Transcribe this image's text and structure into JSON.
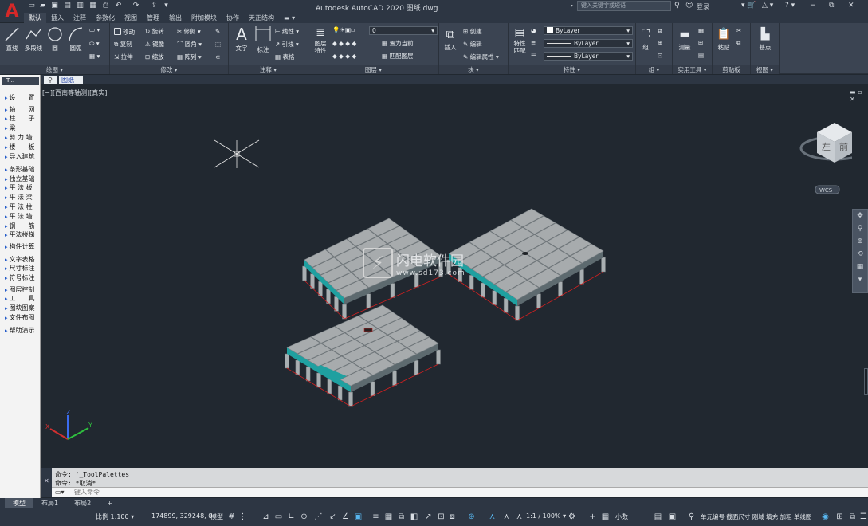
{
  "app": {
    "title": "Autodesk AutoCAD 2020    图纸.dwg",
    "logo": "A",
    "search_placeholder": "键入关键字或短语",
    "login": "登录"
  },
  "ribbon_tabs": [
    "默认",
    "插入",
    "注释",
    "参数化",
    "视图",
    "管理",
    "输出",
    "附加模块",
    "协作",
    "天正结构"
  ],
  "ribbon": {
    "draw": {
      "title": "绘图 ▾",
      "line": "直线",
      "polyline": "多段线",
      "circle": "圆",
      "arc": "圆弧"
    },
    "modify": {
      "title": "修改 ▾",
      "move": "移动",
      "rotate": "旋转",
      "trim": "修剪",
      "copy": "复制",
      "mirror": "镜像",
      "fillet": "圆角",
      "stretch": "拉伸",
      "scale": "缩放",
      "array": "阵列"
    },
    "annotation": {
      "title": "注释 ▾",
      "text": "文字",
      "dimension": "标注",
      "linear": "线性",
      "leader": "引线",
      "table": "表格"
    },
    "layers": {
      "title": "图层 ▾",
      "props": "图层\n特性",
      "layer_value": "0",
      "make_current": "置为当前",
      "match_layer": "匹配图层"
    },
    "block": {
      "title": "块 ▾",
      "insert": "插入",
      "create": "创建",
      "edit": "编辑",
      "edit_attr": "编辑属性"
    },
    "properties": {
      "title": "特性 ▾",
      "match": "特性\n匹配",
      "color": "ByLayer",
      "linetype": "ByLayer",
      "lineweight": "ByLayer"
    },
    "groups": {
      "title": "组 ▾",
      "group": "组"
    },
    "utilities": {
      "title": "实用工具 ▾",
      "measure": "测量"
    },
    "clipboard": {
      "title": "剪贴板",
      "paste": "粘贴"
    },
    "view": {
      "title": "视图 ▾",
      "base": "基点"
    }
  },
  "doc_tab": "图纸",
  "palette": {
    "header": "T...",
    "items": [
      "设　　置",
      "轴　　网",
      "柱　　子",
      "梁",
      "剪 力 墙",
      "楼　　板",
      "导入建筑",
      "条形基础",
      "独立基础",
      "平 法 板",
      "平 法 梁",
      "平 法 柱",
      "平 法 墙",
      "钢　　筋",
      "平法楼梯",
      "构件计算",
      "文字表格",
      "尺寸标注",
      "符号标注",
      "图层控制",
      "工　　具",
      "图块图案",
      "文件布图",
      "帮助演示"
    ]
  },
  "viewport": {
    "label": "[−][西南等轴测][真实]",
    "controls": "▬ ▫ ✕",
    "viewcube_faces": {
      "left": "左",
      "front": "前"
    },
    "wcs": "WCS",
    "axes": {
      "x": "X",
      "y": "Y",
      "z": "Z"
    }
  },
  "watermark": {
    "name": "闪电软件园",
    "url": "www.sd173.com"
  },
  "command": {
    "history": [
      "命令: '_ToolPalettes",
      "命令: *取消*"
    ],
    "placeholder": "键入命令"
  },
  "layout_tabs": [
    "模型",
    "布局1",
    "布局2",
    "+"
  ],
  "status": {
    "scale": "比例 1:100 ▾",
    "coords": "174899, 329248, 0",
    "model": "模型",
    "annoscale": "1:1 / 100% ▾",
    "units": "小数",
    "info": "单元编号 截面尺寸 刚域 填充 加粗 单线图"
  },
  "colors": {
    "accent": "#58b7f0",
    "slab": "#a7abad",
    "column": "#a9afb2",
    "beam_outline": "#d12020",
    "teal": "#1fa0a0",
    "background": "#212830"
  }
}
